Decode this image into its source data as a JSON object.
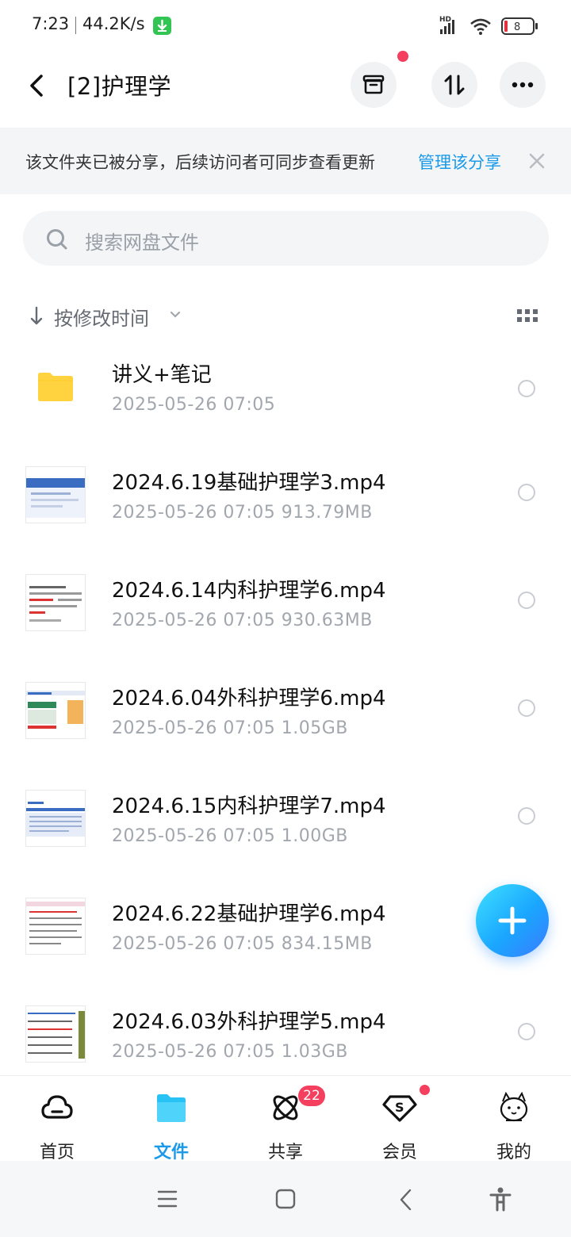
{
  "status_bar": {
    "time": "7:23",
    "net_speed": "44.2K/s",
    "battery_level": "8",
    "signal_label": "HD"
  },
  "header": {
    "title": "[2]护理学"
  },
  "share_banner": {
    "text": "该文件夹已被分享，后续访问者可同步查看更新",
    "link": "管理该分享"
  },
  "search": {
    "placeholder": "搜索网盘文件"
  },
  "sort": {
    "label": "按修改时间"
  },
  "files": [
    {
      "name": "讲义+笔记",
      "date": "2025-05-26  07:05",
      "size": "",
      "type": "folder"
    },
    {
      "name": "2024.6.19基础护理学3.mp4",
      "date": "2025-05-26  07:05",
      "size": "913.79MB",
      "type": "video"
    },
    {
      "name": "2024.6.14内科护理学6.mp4",
      "date": "2025-05-26  07:05",
      "size": "930.63MB",
      "type": "video"
    },
    {
      "name": "2024.6.04外科护理学6.mp4",
      "date": "2025-05-26  07:05",
      "size": "1.05GB",
      "type": "video"
    },
    {
      "name": "2024.6.15内科护理学7.mp4",
      "date": "2025-05-26  07:05",
      "size": "1.00GB",
      "type": "video"
    },
    {
      "name": "2024.6.22基础护理学6.mp4",
      "date": "2025-05-26  07:05",
      "size": "834.15MB",
      "type": "video"
    },
    {
      "name": "2024.6.03外科护理学5.mp4",
      "date": "2025-05-26  07:05",
      "size": "1.03GB",
      "type": "video"
    }
  ],
  "bottom_nav": {
    "tabs": [
      {
        "label": "首页",
        "icon": "cloud-icon"
      },
      {
        "label": "文件",
        "icon": "folder-icon",
        "active": true
      },
      {
        "label": "共享",
        "icon": "share-atom-icon",
        "badge": "22"
      },
      {
        "label": "会员",
        "icon": "vip-shield-icon"
      },
      {
        "label": "我的",
        "icon": "avatar-icon"
      }
    ]
  },
  "colors": {
    "accent": "#1a9ae8",
    "badge": "#f43f5e",
    "folder": "#ffd23f"
  }
}
